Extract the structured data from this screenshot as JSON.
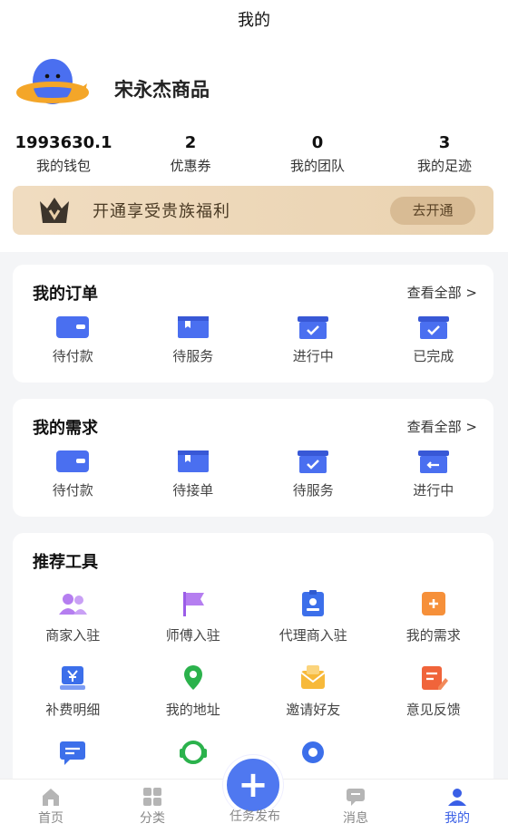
{
  "nav": {
    "title": "我的"
  },
  "profile": {
    "name": "宋永杰商品"
  },
  "stats": [
    {
      "value": "1993630.1",
      "label": "我的钱包"
    },
    {
      "value": "2",
      "label": "优惠券"
    },
    {
      "value": "0",
      "label": "我的团队"
    },
    {
      "value": "3",
      "label": "我的足迹"
    }
  ],
  "vip": {
    "text": "开通享受贵族福利",
    "button": "去开通"
  },
  "orders": {
    "title": "我的订单",
    "more": "查看全部 >",
    "items": [
      "待付款",
      "待服务",
      "进行中",
      "已完成"
    ]
  },
  "needs": {
    "title": "我的需求",
    "more": "查看全部 >",
    "items": [
      "待付款",
      "待接单",
      "待服务",
      "进行中"
    ]
  },
  "tools": {
    "title": "推荐工具",
    "items": [
      "商家入驻",
      "师傅入驻",
      "代理商入驻",
      "我的需求",
      "补费明细",
      "我的地址",
      "邀请好友",
      "意见反馈",
      "",
      "",
      ""
    ]
  },
  "tabbar": {
    "items": [
      "首页",
      "分类",
      "任务发布",
      "消息",
      "我的"
    ],
    "active": "我的"
  },
  "colors": {
    "accent": "#4f78f0",
    "gold": "#ead3b1"
  }
}
